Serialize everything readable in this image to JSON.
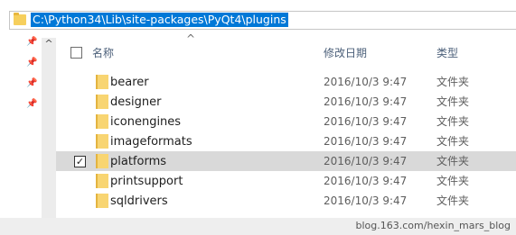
{
  "address_bar": {
    "path": "C:\\Python34\\Lib\\site-packages\\PyQt4\\plugins"
  },
  "nav": {
    "scroll_up_glyph": "^",
    "pin_glyph": "📌"
  },
  "header": {
    "sort_glyph": "^",
    "name": "名称",
    "date": "修改日期",
    "type": "类型"
  },
  "rows": [
    {
      "name": "bearer",
      "date": "2016/10/3 9:47",
      "type": "文件夹",
      "checked": false,
      "selected": false
    },
    {
      "name": "designer",
      "date": "2016/10/3 9:47",
      "type": "文件夹",
      "checked": false,
      "selected": false
    },
    {
      "name": "iconengines",
      "date": "2016/10/3 9:47",
      "type": "文件夹",
      "checked": false,
      "selected": false
    },
    {
      "name": "imageformats",
      "date": "2016/10/3 9:47",
      "type": "文件夹",
      "checked": false,
      "selected": false
    },
    {
      "name": "platforms",
      "date": "2016/10/3 9:47",
      "type": "文件夹",
      "checked": true,
      "selected": true
    },
    {
      "name": "printsupport",
      "date": "2016/10/3 9:47",
      "type": "文件夹",
      "checked": false,
      "selected": false
    },
    {
      "name": "sqldrivers",
      "date": "2016/10/3 9:47",
      "type": "文件夹",
      "checked": false,
      "selected": false
    }
  ],
  "watermark": "blog.163.com/hexin_mars_blog",
  "colors": {
    "selection_blue": "#0078d7",
    "folder_yellow": "#f8d572",
    "row_selected": "#d9d9d9"
  }
}
